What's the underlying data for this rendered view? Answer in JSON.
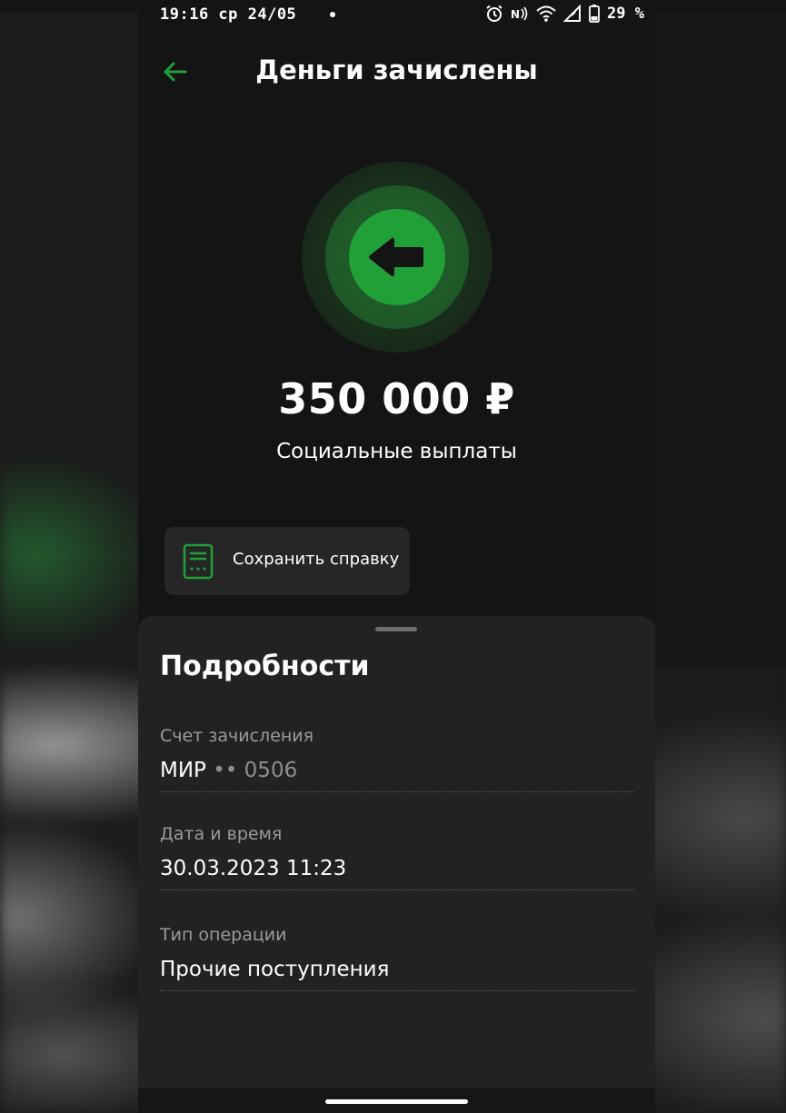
{
  "status_bar": {
    "time": "19:16 ср 24/05",
    "battery_percent": "29 %",
    "icons": [
      "alarm-icon",
      "nfc-icon",
      "wifi-icon",
      "signal-icon",
      "battery-icon"
    ]
  },
  "header": {
    "title": "Деньги зачислены",
    "back_icon": "arrow-left-icon"
  },
  "hero": {
    "icon": "incoming-arrow-icon",
    "amount": "350 000 ₽",
    "description": "Социальные выплаты"
  },
  "actions": {
    "save_certificate_label": "Сохранить справку",
    "save_certificate_icon": "document-icon"
  },
  "details": {
    "title": "Подробности",
    "account": {
      "label": "Счет зачисления",
      "card_brand": "МИР",
      "card_masked": "•• 0506"
    },
    "datetime": {
      "label": "Дата и время",
      "value": "30.03.2023 11:23"
    },
    "operation_type": {
      "label": "Тип операции",
      "value": "Прочие поступления"
    }
  },
  "colors": {
    "accent_green": "#21a038",
    "background": "#141414",
    "sheet": "#222222",
    "secondary_text": "#9a9a9a"
  }
}
